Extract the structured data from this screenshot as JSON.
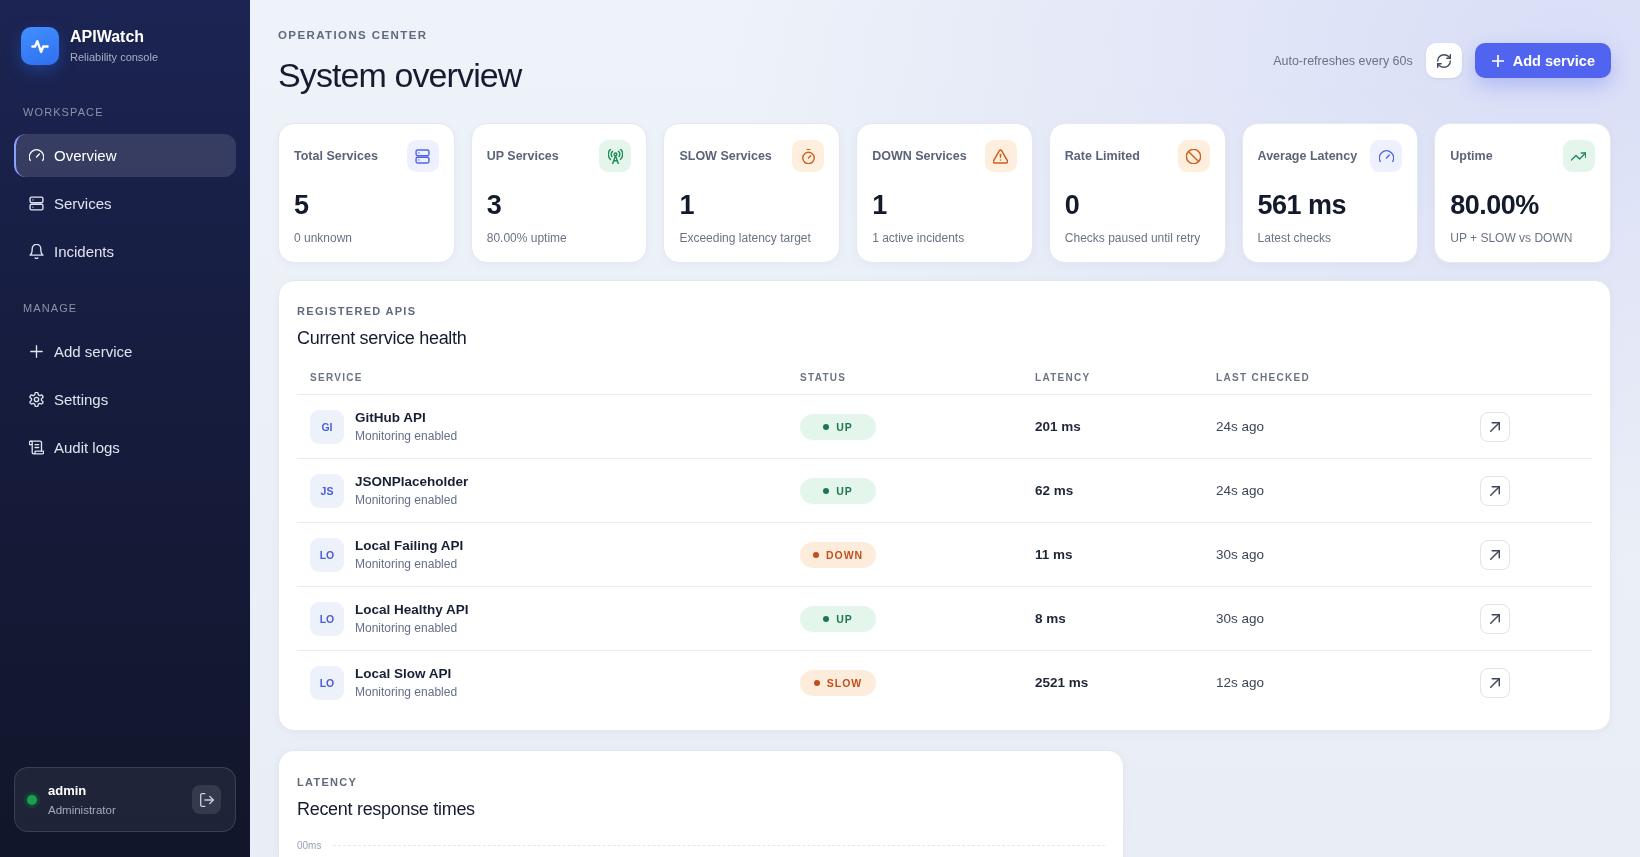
{
  "sidebar": {
    "brand": {
      "name": "APIWatch",
      "tagline": "Reliability console"
    },
    "sections": [
      {
        "heading": "WORKSPACE",
        "items": [
          {
            "kind": "overview",
            "label": "Overview",
            "selected": true
          },
          {
            "kind": "services",
            "label": "Services",
            "selected": false
          },
          {
            "kind": "incidents",
            "label": "Incidents",
            "selected": false
          }
        ]
      },
      {
        "heading": "MANAGE",
        "items": [
          {
            "kind": "add",
            "label": "Add service",
            "selected": false
          },
          {
            "kind": "settings",
            "label": "Settings",
            "selected": false
          },
          {
            "kind": "audit",
            "label": "Audit logs",
            "selected": false
          }
        ]
      }
    ],
    "user": {
      "name": "admin",
      "role": "Administrator",
      "online": true
    }
  },
  "header": {
    "eyebrow": "OPERATIONS CENTER",
    "title": "System overview",
    "refresh_note": "Auto-refreshes every 60s",
    "add_button": "Add service"
  },
  "stats": [
    {
      "kind": "total",
      "label": "Total Services",
      "value": "5",
      "note": "0 unknown"
    },
    {
      "kind": "up",
      "label": "UP Services",
      "value": "3",
      "note": "80.00% uptime"
    },
    {
      "kind": "slow",
      "label": "SLOW Services",
      "value": "1",
      "note": "Exceeding latency target"
    },
    {
      "kind": "down",
      "label": "DOWN Services",
      "value": "1",
      "note": "1 active incidents"
    },
    {
      "kind": "limited",
      "label": "Rate Limited",
      "value": "0",
      "note": "Checks paused until retry"
    },
    {
      "kind": "latency",
      "label": "Average Latency",
      "value": "561 ms",
      "note": "Latest checks"
    },
    {
      "kind": "uptime",
      "label": "Uptime",
      "value": "80.00%",
      "note": "UP + SLOW vs DOWN"
    }
  ],
  "services_table": {
    "eyebrow": "REGISTERED APIS",
    "title": "Current service health",
    "columns": [
      "SERVICE",
      "STATUS",
      "LATENCY",
      "LAST CHECKED"
    ],
    "rows": [
      {
        "initials": "GI",
        "name": "GitHub API",
        "subtitle": "Monitoring enabled",
        "status": {
          "label": "UP",
          "kind": "up"
        },
        "latency": "201 ms",
        "last_checked": "24s ago"
      },
      {
        "initials": "JS",
        "name": "JSONPlaceholder",
        "subtitle": "Monitoring enabled",
        "status": {
          "label": "UP",
          "kind": "up"
        },
        "latency": "62 ms",
        "last_checked": "24s ago"
      },
      {
        "initials": "LO",
        "name": "Local Failing API",
        "subtitle": "Monitoring enabled",
        "status": {
          "label": "DOWN",
          "kind": "down"
        },
        "latency": "11 ms",
        "last_checked": "30s ago"
      },
      {
        "initials": "LO",
        "name": "Local Healthy API",
        "subtitle": "Monitoring enabled",
        "status": {
          "label": "UP",
          "kind": "up"
        },
        "latency": "8 ms",
        "last_checked": "30s ago"
      },
      {
        "initials": "LO",
        "name": "Local Slow API",
        "subtitle": "Monitoring enabled",
        "status": {
          "label": "SLOW",
          "kind": "slow"
        },
        "latency": "2521 ms",
        "last_checked": "12s ago"
      }
    ]
  },
  "latency_panel": {
    "eyebrow": "LATENCY",
    "title": "Recent response times",
    "axis_label": "00ms"
  }
}
